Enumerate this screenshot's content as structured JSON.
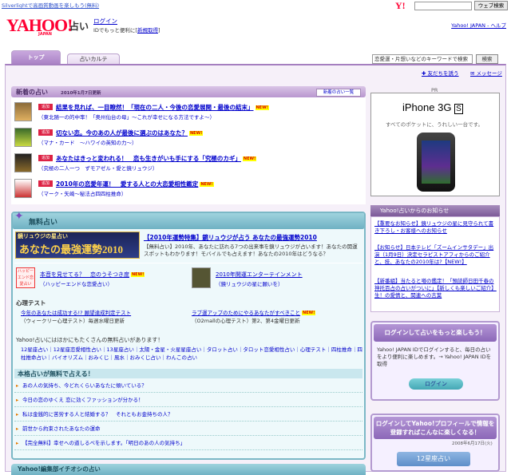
{
  "topbar": {
    "silverlight_link": "Silverlightで高画質動画を楽しもう(無料)",
    "search_button": "ウェブ検索"
  },
  "header": {
    "logo": "YAHOO!",
    "logo_sub": "JAPAN",
    "service": "占い",
    "login_link": "ログイン",
    "login_sub_text": "IDでもっと便利に[",
    "login_sub_link": "新規取得",
    "login_sub_end": "]",
    "right_links": "Yahoo! JAPAN - ヘルプ"
  },
  "tabs": [
    {
      "label": "トップ"
    },
    {
      "label": "占いカルテ"
    }
  ],
  "search": {
    "placeholder": "恋愛運・片想いなどのキーワードで検索",
    "button": "検索"
  },
  "share": {
    "send": "友だちを誘う",
    "message": "メッセージ"
  },
  "news": {
    "title": "新着の占い",
    "date": "2010年1月7日更新",
    "list_button": "新着の占い一覧",
    "items": [
      {
        "badge": "追加",
        "title": "結果を見れば、一目瞭然！「現在の二人・今後の恋愛展開・最後の結末」",
        "new": "NEW!",
        "sub": "（東北随一の的中率！「奥州仙台の母」～これが幸せになる方法ですよ～）"
      },
      {
        "badge": "追加",
        "title": "切ない恋。今のあの人が最後に選ぶのはあなた？",
        "new": "NEW!",
        "sub": "（マナ・カード　～ハワイの英知の力～）"
      },
      {
        "badge": "追加",
        "title": "あなたはきっと変われる！　恋も生きがいも手にする「究極のカギ」",
        "new": "NEW!",
        "sub": "（究極の二人一つ　ずモアゼル・愛と鏡リュウジ）"
      },
      {
        "badge": "追加",
        "title": "2010年の恋愛年運！　愛する人との大恋愛相性鑑定",
        "new": "NEW!",
        "sub": "（マーク・矢崎～秘法占四四柱推命）"
      }
    ]
  },
  "ad": {
    "pr": "PR",
    "title": "iPhone 3G",
    "title_s": "S",
    "sub": "すべてのポケットに、うれしい一台です。"
  },
  "notice": {
    "title": "Yahoo!占いからのお知らせ",
    "items": [
      "【重要なお知らせ】鏡リュウジの星に見守られて書き下ろし・お客様へのお知らせ",
      "【お知らせ】日本テレビ「ズームインサタデー」出演（1月9日）決定セラピストアフィからのご紹介と、技、あなたの2010年は?【NEW!】",
      "【新番組】当たると噂の鑑定！「預読師日田千春の神托百占の占いがついに」【新しくも楽しいご紹介】生！の愛情と、関連への言葉"
    ]
  },
  "login_box": {
    "title": "ログインして占いをもっと楽しもう！",
    "text": "Yahoo! JAPAN IDでログインすると、毎日の占いをより便利に楽しめます。→ Yahoo! JAPAN IDを取得",
    "button": "ログイン"
  },
  "profile_box": {
    "title": "ログインしてYahoo!プロフィールで情報を登録すればこんなに楽しくなる！",
    "date": "2008年6月17日(火)",
    "seiza": "12星座占い"
  },
  "free": {
    "title": "無料占い",
    "banner_line1": "鏡リュウジの星占い",
    "banner_line2": "あなたの最強運勢2010",
    "feature_title": "【2010年運勢特集】鏡リュウジが占う あなたの最強運勢2010",
    "feature_text": "【無料占い】2010年、あなたに訪れる7つの出来事を鏡リュウジが占います！あなたの開運スポットもわかります！モバイルでも占えます！あなたの2010年はどうなる？",
    "card1_img": "ハッピーエンド恋愛占い",
    "card1_title": "本音を見せてる？　恋のうそつき度",
    "card1_new": "NEW!",
    "card1_sub": "（ハッピーエンドな恋愛占い）",
    "card2_title": "2010年開運エンターテインメント",
    "card2_sub": "（鏡リュウジの星に願いを）",
    "psy_title": "心理テスト",
    "psy1_title": "今年のあなたは成功する!? 願望達成判定テスト",
    "psy1_sub": "（ウィークリー心理テスト）毎週水曜日更新",
    "psy2_title": "ラブ運アップのためにやるあなたがすべきこと",
    "psy2_new": "NEW!",
    "psy2_sub": "（O2mallの心理テスト）第2、第4金曜日更新",
    "more_text": "Yahoo!占いにはほかにもたくさんの無料占いがあります！",
    "categories": "12星座占い｜12星座恋愛相性占い｜13星座占い｜太陽・金星・火星星座占い｜タロット占い｜タロット恋愛相性占い｜心理テスト｜四柱推命｜四柱推命占い｜バイオリズム｜おみくじ｜風水｜おみくじ占い｜わんこの占い",
    "honkaku_title": "本格占いが無料で占える！",
    "honkaku": [
      "あの人の気持ち、今どれくらいあなたに傾いている？",
      "今日の恋のゆくえ 恋に効くファッションが分かる！",
      "私は金銭的に苦労する人と結婚する？　それともお金持ちの人？",
      "前世から約束されたあなたの運命",
      "【完全無料】幸せへの道しるべを示します。「明日のあの人の気持ち」"
    ],
    "bottom_title": "Yahoo!編集部イチオシの占い"
  }
}
